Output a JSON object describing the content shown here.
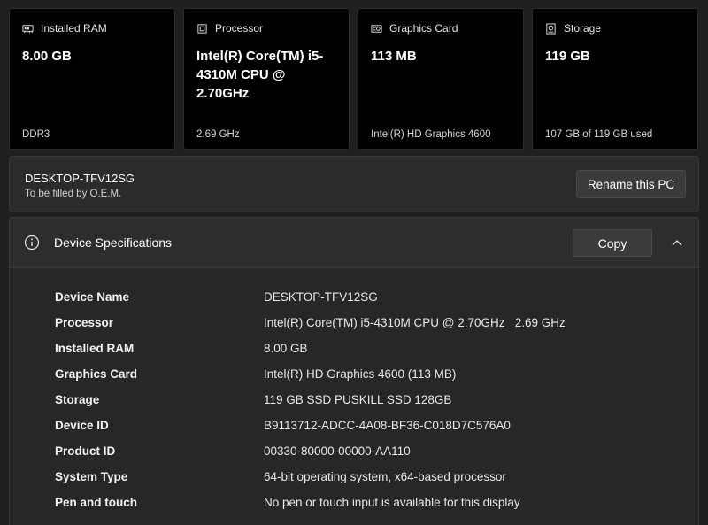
{
  "cards": [
    {
      "title": "Installed RAM",
      "icon": "ram-icon",
      "value": "8.00 GB",
      "sub": "DDR3"
    },
    {
      "title": "Processor",
      "icon": "processor-icon",
      "value": "Intel(R) Core(TM) i5-4310M CPU @ 2.70GHz",
      "sub": "2.69 GHz"
    },
    {
      "title": "Graphics Card",
      "icon": "graphics-card-icon",
      "value": "113 MB",
      "sub": "Intel(R) HD Graphics 4600"
    },
    {
      "title": "Storage",
      "icon": "storage-icon",
      "value": "119 GB",
      "sub": "107 GB of 119 GB used"
    }
  ],
  "device": {
    "name": "DESKTOP-TFV12SG",
    "description": "To be filled by O.E.M.",
    "rename_label": "Rename this PC"
  },
  "specs": {
    "title": "Device Specifications",
    "copy_label": "Copy",
    "rows": [
      {
        "label": "Device Name",
        "value": "DESKTOP-TFV12SG"
      },
      {
        "label": "Processor",
        "value": "Intel(R) Core(TM) i5-4310M CPU @ 2.70GHz   2.69 GHz"
      },
      {
        "label": "Installed RAM",
        "value": "8.00 GB"
      },
      {
        "label": "Graphics Card",
        "value": "Intel(R) HD Graphics 4600 (113 MB)"
      },
      {
        "label": "Storage",
        "value": "119 GB SSD PUSKILL SSD 128GB"
      },
      {
        "label": "Device ID",
        "value": "B9113712-ADCC-4A08-BF36-C018D7C576A0"
      },
      {
        "label": "Product ID",
        "value": "00330-80000-00000-AA110"
      },
      {
        "label": "System Type",
        "value": "64-bit operating system, x64-based processor"
      },
      {
        "label": "Pen and touch",
        "value": "No pen or touch input is available for this display"
      }
    ]
  }
}
